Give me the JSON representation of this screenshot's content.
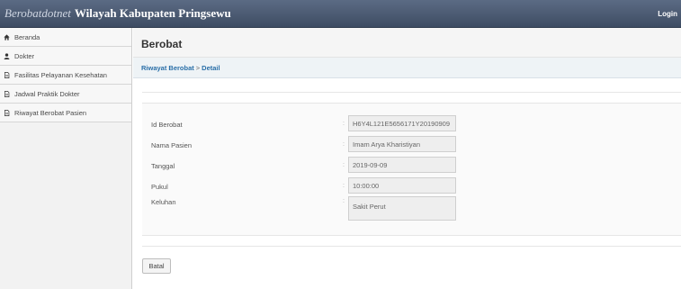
{
  "topbar": {
    "brand_prefix": "Berobatdotnet",
    "brand_title": "Wilayah Kabupaten Pringsewu",
    "login_label": "Login"
  },
  "sidebar": {
    "items": [
      {
        "label": "Beranda",
        "icon": "home-icon"
      },
      {
        "label": "Dokter",
        "icon": "user-icon"
      },
      {
        "label": "Fasilitas Pelayanan Kesehatan",
        "icon": "document-icon"
      },
      {
        "label": "Jadwal Praktik Dokter",
        "icon": "document-icon"
      },
      {
        "label": "Riwayat Berobat Pasien",
        "icon": "document-icon"
      }
    ]
  },
  "page": {
    "title": "Berobat",
    "breadcrumb": {
      "parent": "Riwayat Berobat",
      "separator": ">",
      "current": "Detail"
    }
  },
  "form": {
    "fields": [
      {
        "label": "Id Berobat",
        "value": "H6Y4L121E5656171Y20190909"
      },
      {
        "label": "Nama Pasien",
        "value": "Imam Arya Kharistiyan"
      },
      {
        "label": "Tanggal",
        "value": "2019-09-09"
      },
      {
        "label": "Pukul",
        "value": "10:00:00"
      },
      {
        "label": "Keluhan",
        "value": "Sakit Perut"
      }
    ],
    "colon": ":",
    "cancel_label": "Batal"
  }
}
